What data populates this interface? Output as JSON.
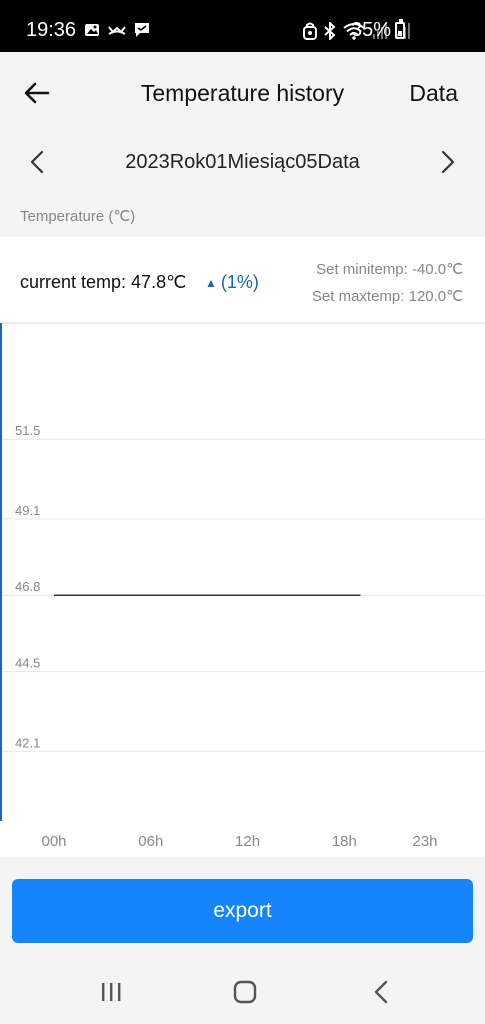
{
  "status_bar": {
    "time": "19:36",
    "battery": "35%",
    "battery_level": 0.35
  },
  "header": {
    "title": "Temperature history",
    "data_label": "Data"
  },
  "date_nav": {
    "date_text": "2023Rok01Miesiąc05Data"
  },
  "unit_label": "Temperature (℃)",
  "stats": {
    "current_temp": "current temp: 47.8℃",
    "trend": "(1%)",
    "min_temp": "Set minitemp: -40.0℃",
    "max_temp": "Set maxtemp: 120.0℃"
  },
  "chart_data": {
    "type": "line",
    "y_ticks": [
      "51.5",
      "49.1",
      "46.8",
      "44.5",
      "42.1"
    ],
    "y_tick_values": [
      51.5,
      49.1,
      46.8,
      44.5,
      42.1
    ],
    "x_ticks": [
      "00h",
      "06h",
      "12h",
      "18h",
      "23h"
    ],
    "x_tick_values": [
      0,
      6,
      12,
      18,
      23
    ],
    "ylim": [
      40.0,
      55.0
    ],
    "xlim": [
      0,
      23
    ],
    "grid": true,
    "series": [
      {
        "x": [
          0,
          19
        ],
        "values": [
          46.8,
          46.8
        ]
      }
    ],
    "colors": {
      "line": "#333333",
      "axis": "#1c67ad",
      "grid": "#e6e6e6",
      "tick": "#888888"
    }
  },
  "export_label": "export",
  "colors": {
    "accent": "#1684fb",
    "trend": "#1c67ad"
  },
  "nav_icons": [
    "recents-icon",
    "home-icon",
    "back-icon"
  ]
}
